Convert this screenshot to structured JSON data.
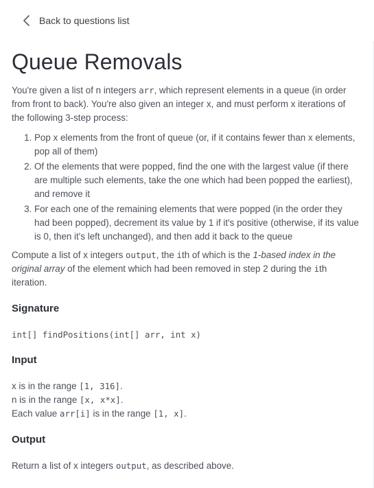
{
  "nav": {
    "back_label": "Back to questions list",
    "back_icon": "chevron-left-icon"
  },
  "problem": {
    "title": "Queue Removals",
    "intro": {
      "t1": "You're given a list of ",
      "n": "n",
      "t2": " integers ",
      "arr": "arr",
      "t3": ", which represent elements in a queue (in order from front to back). You're also given an integer ",
      "x": "x",
      "t4": ", and must perform ",
      "x2": "x",
      "t5": " iterations of the following 3-step process:"
    },
    "steps": [
      {
        "a": "Pop ",
        "x": "x",
        "b": " elements from the front of queue (or, if it contains fewer than ",
        "x2": "x",
        "c": " elements, pop all of them)"
      },
      {
        "a": "Of the elements that were popped, find the one with the largest value (if there are multiple such elements, take the one which had been popped the earliest), and remove it"
      },
      {
        "a": "For each one of the remaining elements that were popped (in the order they had been popped), decrement its value by 1 if it's positive (otherwise, if its value is 0, then it's left unchanged), and then add it back to the queue"
      }
    ],
    "compute": {
      "a": "Compute a list of ",
      "x": "x",
      "b": " integers ",
      "output": "output",
      "c": ", the ",
      "i": "i",
      "d": "th of which is the ",
      "em": "1-based index in the original array",
      "e": " of the element which had been removed in step 2 during the ",
      "i2": "i",
      "f": "th iteration."
    },
    "signature": {
      "heading": "Signature",
      "code": "int[] findPositions(int[] arr, int x)"
    },
    "input": {
      "heading": "Input",
      "line1": {
        "a": "x",
        "b": " is in the range ",
        "code": "[1, 316]",
        "c": "."
      },
      "line2": {
        "a": "n",
        "b": " is in the range ",
        "code": "[x, x*x]",
        "c": "."
      },
      "line3": {
        "a": "Each value ",
        "code1": "arr[i]",
        "b": " is in the range ",
        "code2": "[1, x]",
        "c": "."
      }
    },
    "output": {
      "heading": "Output",
      "a": "Return a list of ",
      "x": "x",
      "b": " integers ",
      "code": "output",
      "c": ", as described above."
    }
  }
}
